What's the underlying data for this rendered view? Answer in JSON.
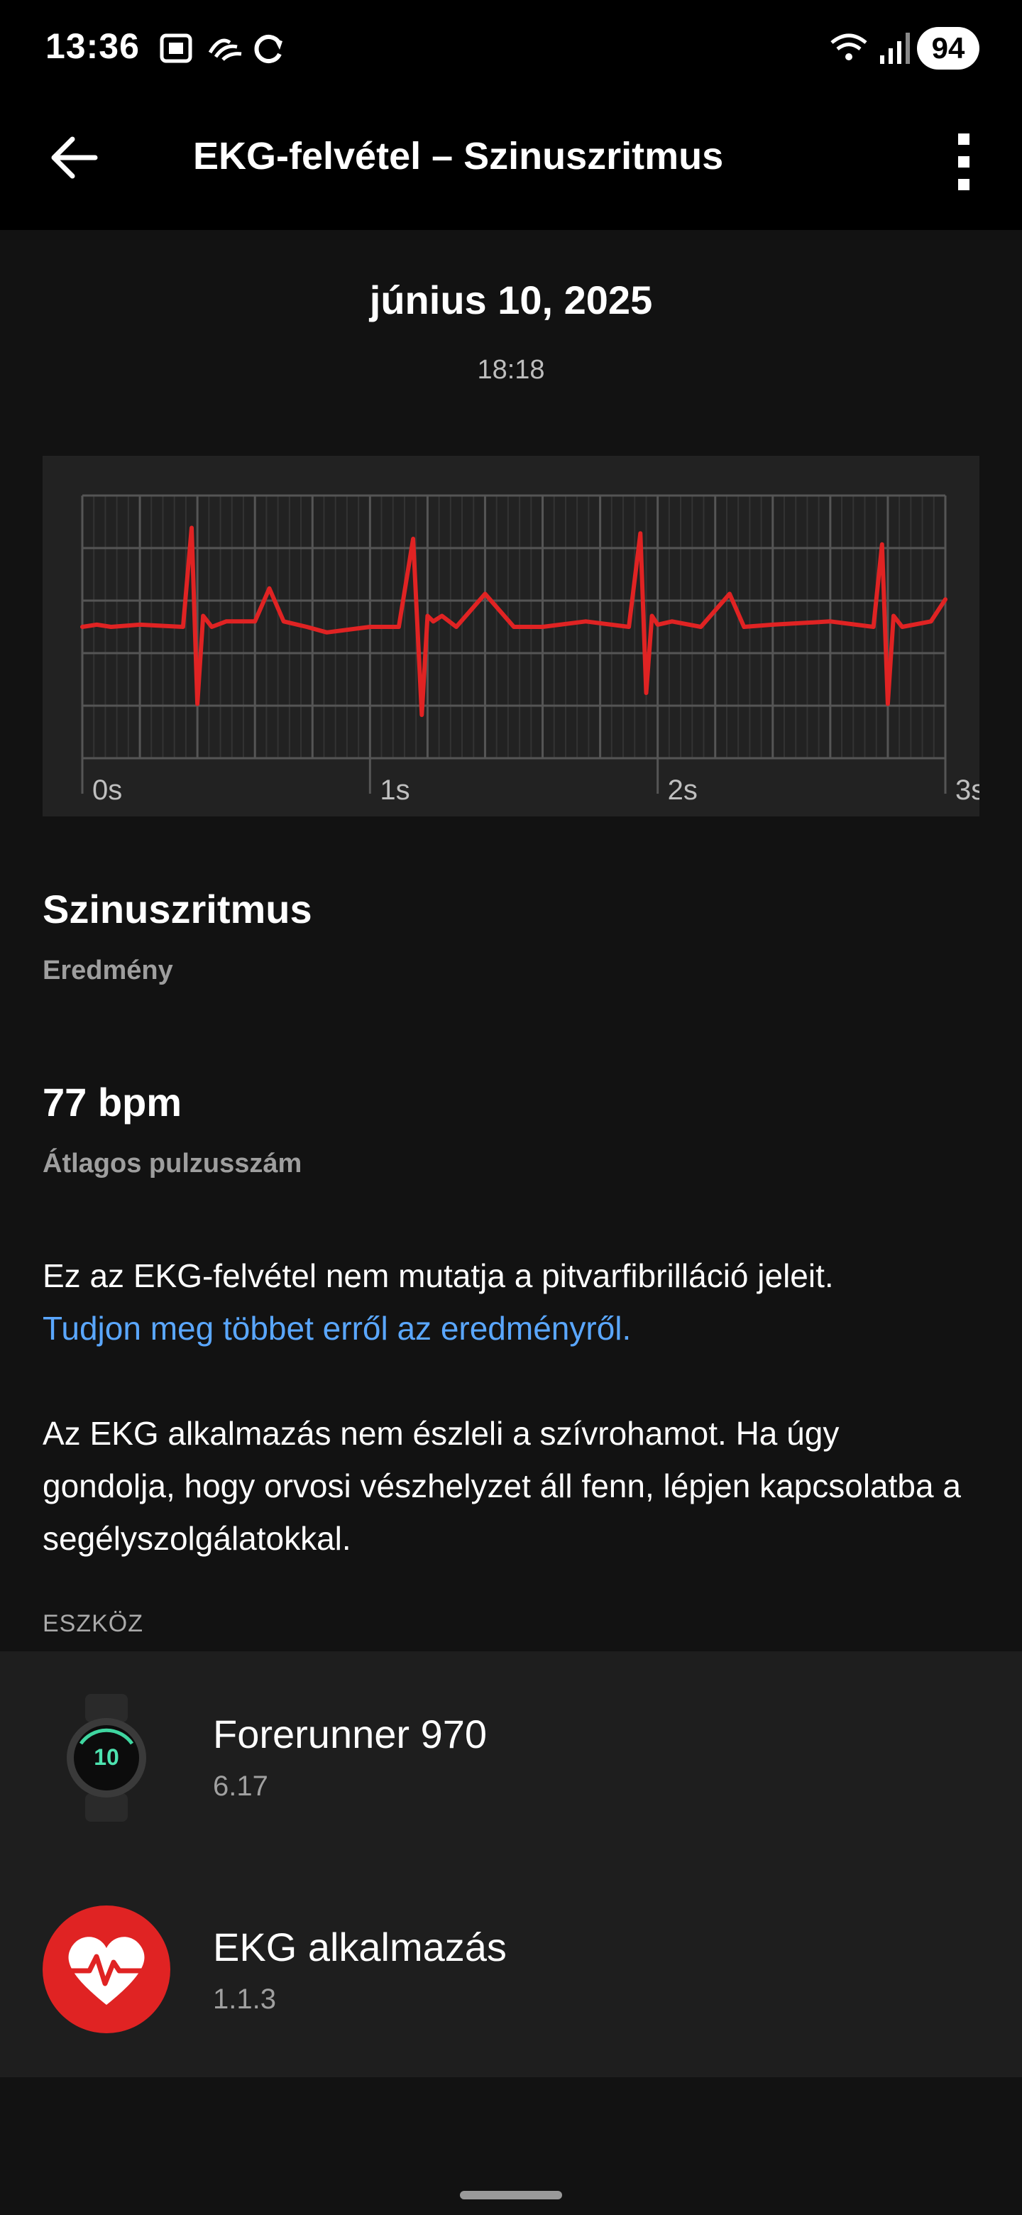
{
  "status": {
    "time": "13:36",
    "battery": "94",
    "icons": [
      "screenshot-icon",
      "activity-icon",
      "sync-icon",
      "wifi-icon",
      "signal-icon"
    ]
  },
  "appbar": {
    "title": "EKG-felvétel – Szinuszritmus",
    "back_icon": "arrow-left-icon",
    "more_icon": "more-vertical-icon"
  },
  "recording": {
    "date": "június 10, 2025",
    "time": "18:18"
  },
  "chart_data": {
    "type": "line",
    "title": "",
    "xlabel": "",
    "ylabel": "",
    "xlim": [
      0,
      3
    ],
    "x_ticks": [
      "0s",
      "1s",
      "2s",
      "3s"
    ],
    "grid": true,
    "color": "#e02323",
    "series": [
      {
        "x": [
          0,
          0.05,
          0.1,
          0.2,
          0.35,
          0.38,
          0.4,
          0.42,
          0.45,
          0.5,
          0.6,
          0.65,
          0.7,
          0.78,
          0.85,
          1.0,
          1.1,
          1.15,
          1.18,
          1.2,
          1.22,
          1.25,
          1.3,
          1.4,
          1.5,
          1.6,
          1.75,
          1.9,
          1.94,
          1.96,
          1.98,
          2.0,
          2.05,
          2.15,
          2.25,
          2.3,
          2.4,
          2.6,
          2.75,
          2.78,
          2.8,
          2.82,
          2.85,
          2.95,
          3.0
        ],
        "y": [
          0,
          0.02,
          0.0,
          0.02,
          0.0,
          0.9,
          -0.7,
          0.1,
          0.0,
          0.05,
          0.05,
          0.35,
          0.05,
          0.0,
          -0.05,
          0.0,
          0.0,
          0.8,
          -0.8,
          0.1,
          0.05,
          0.1,
          0.0,
          0.3,
          0.0,
          0.0,
          0.05,
          0.0,
          0.85,
          -0.6,
          0.1,
          0.02,
          0.05,
          0.0,
          0.3,
          0.0,
          0.02,
          0.05,
          0.0,
          0.75,
          -0.7,
          0.1,
          0.0,
          0.05,
          0.25
        ]
      }
    ]
  },
  "result": {
    "rhythm": "Szinuszritmus",
    "rhythm_label": "Eredmény",
    "bpm": "77 bpm",
    "bpm_label": "Átlagos pulzusszám",
    "description": "Ez az EKG-felvétel nem mutatja a pitvarfibrilláció jeleit.",
    "link": "Tudjon meg többet erről az eredményről.",
    "warning": "Az EKG alkalmazás nem észleli a szívrohamot. Ha úgy gondolja, hogy orvosi vészhelyzet áll fenn, lépjen kapcsolatba a segélyszolgálatokkal."
  },
  "device_section": {
    "label": "ESZKÖZ",
    "items": [
      {
        "name": "Forerunner 970",
        "version": "6.17",
        "icon": "watch-icon"
      },
      {
        "name": "EKG alkalmazás",
        "version": "1.1.3",
        "icon": "heart-ecg-icon"
      }
    ],
    "watch_face_digits": "10"
  },
  "colors": {
    "accent_link": "#5aa7ff",
    "ecg_line": "#e02323",
    "ekg_app_icon": "#e02323"
  }
}
